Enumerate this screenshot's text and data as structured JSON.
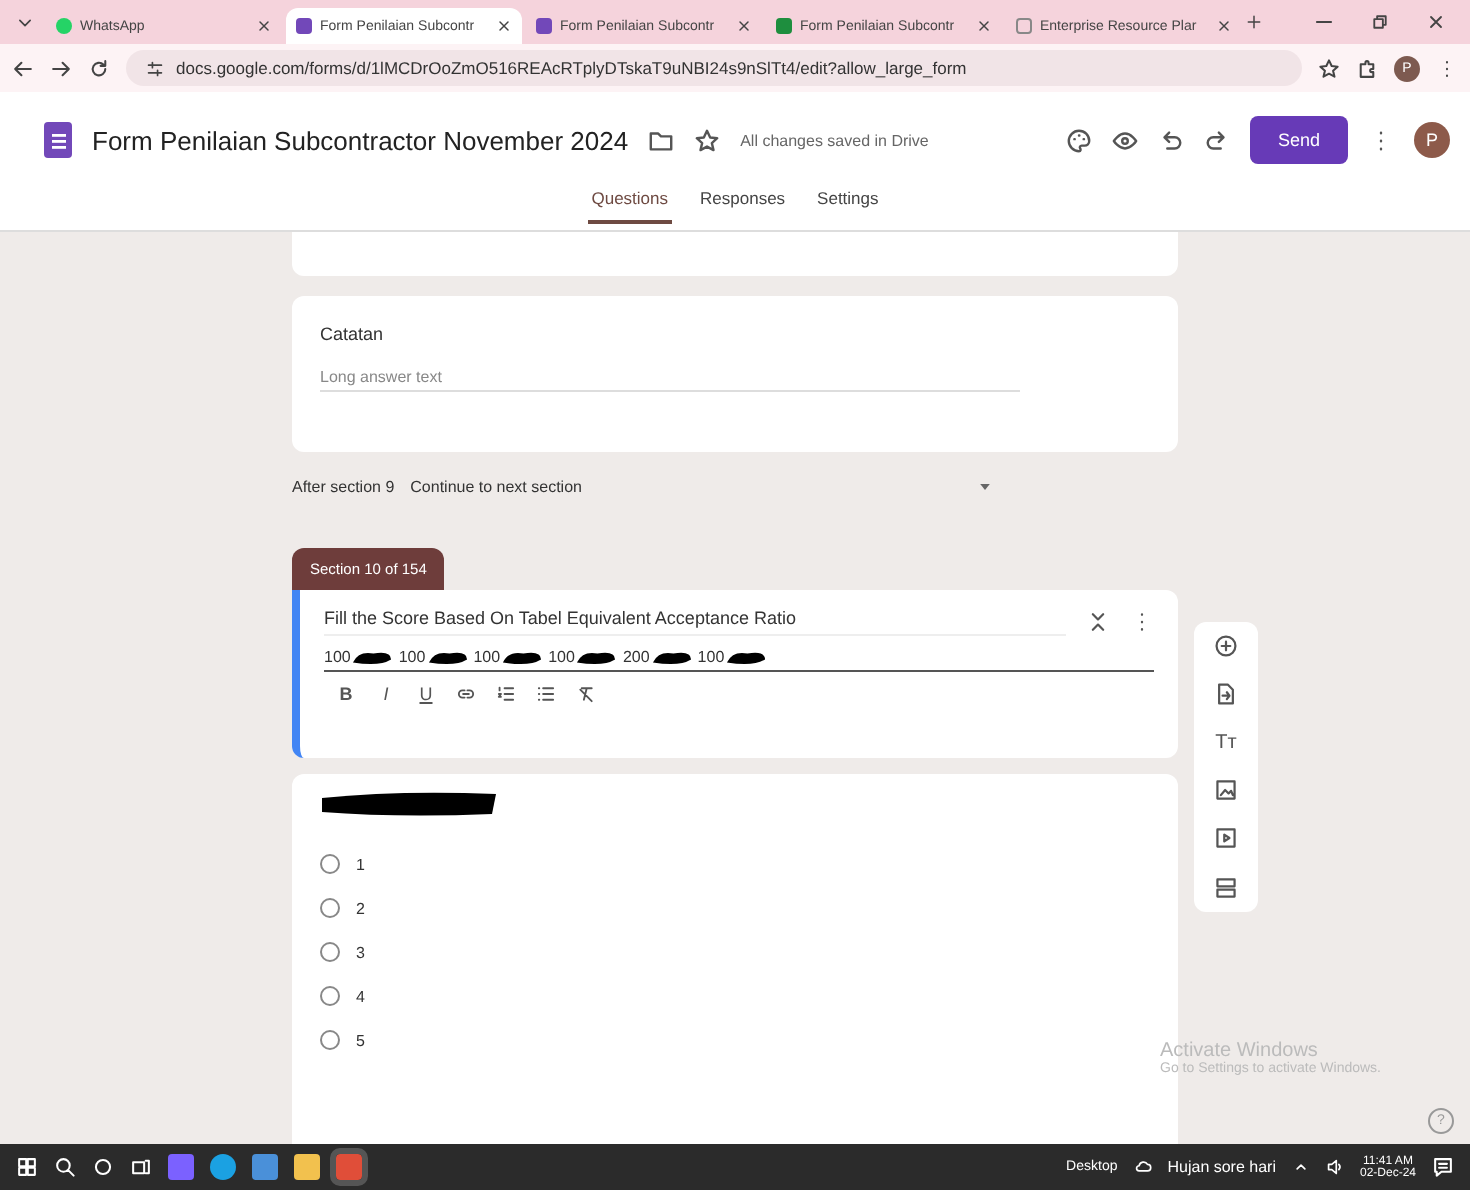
{
  "browser": {
    "tabs": [
      {
        "title": "WhatsApp",
        "kind": "whatsapp",
        "selected": false
      },
      {
        "title": "Form Penilaian Subcontr",
        "kind": "forms",
        "selected": true
      },
      {
        "title": "Form Penilaian Subcontr",
        "kind": "forms",
        "selected": false
      },
      {
        "title": "Form Penilaian Subcontr",
        "kind": "sheets",
        "selected": false
      },
      {
        "title": "Enterprise Resource Plar",
        "kind": "web",
        "selected": false
      }
    ],
    "url": "docs.google.com/forms/d/1lMCDrOoZmO516REAcRTplyDTskaT9uNBI24s9nSlTt4/edit?allow_large_form",
    "profile": "P"
  },
  "form_header": {
    "title": "Form Penilaian Subcontractor November 2024",
    "save_status": "All changes saved in Drive",
    "send": "Send",
    "avatar": "P",
    "tabs": [
      {
        "label": "Questions",
        "selected": true
      },
      {
        "label": "Responses",
        "selected": false
      },
      {
        "label": "Settings",
        "selected": false
      }
    ]
  },
  "catatan": {
    "title": "Catatan",
    "placeholder": "Long answer text"
  },
  "after_section": {
    "label": "After section 9",
    "value": "Continue to next section"
  },
  "section": {
    "tag": "Section 10 of 154",
    "title": "Fill the Score Based On Tabel Equivalent Acceptance Ratio",
    "description_parts": [
      "100",
      "100",
      "100",
      "100",
      "200",
      "100"
    ],
    "format_buttons": [
      "B",
      "I",
      "U"
    ]
  },
  "question": {
    "options": [
      {
        "label": "1",
        "selected": false
      },
      {
        "label": "2",
        "selected": false
      },
      {
        "label": "3",
        "selected": false
      },
      {
        "label": "4",
        "selected": false
      },
      {
        "label": "5",
        "selected": false
      }
    ]
  },
  "side_tools": {
    "title_button": "Tт"
  },
  "activation": {
    "title": "Activate Windows",
    "subtitle": "Go to Settings to activate Windows."
  },
  "help": "?",
  "taskbar": {
    "desktop": "Desktop",
    "weather": "Hujan sore hari",
    "time": "11:41 AM",
    "date": "02-Dec-24"
  }
}
